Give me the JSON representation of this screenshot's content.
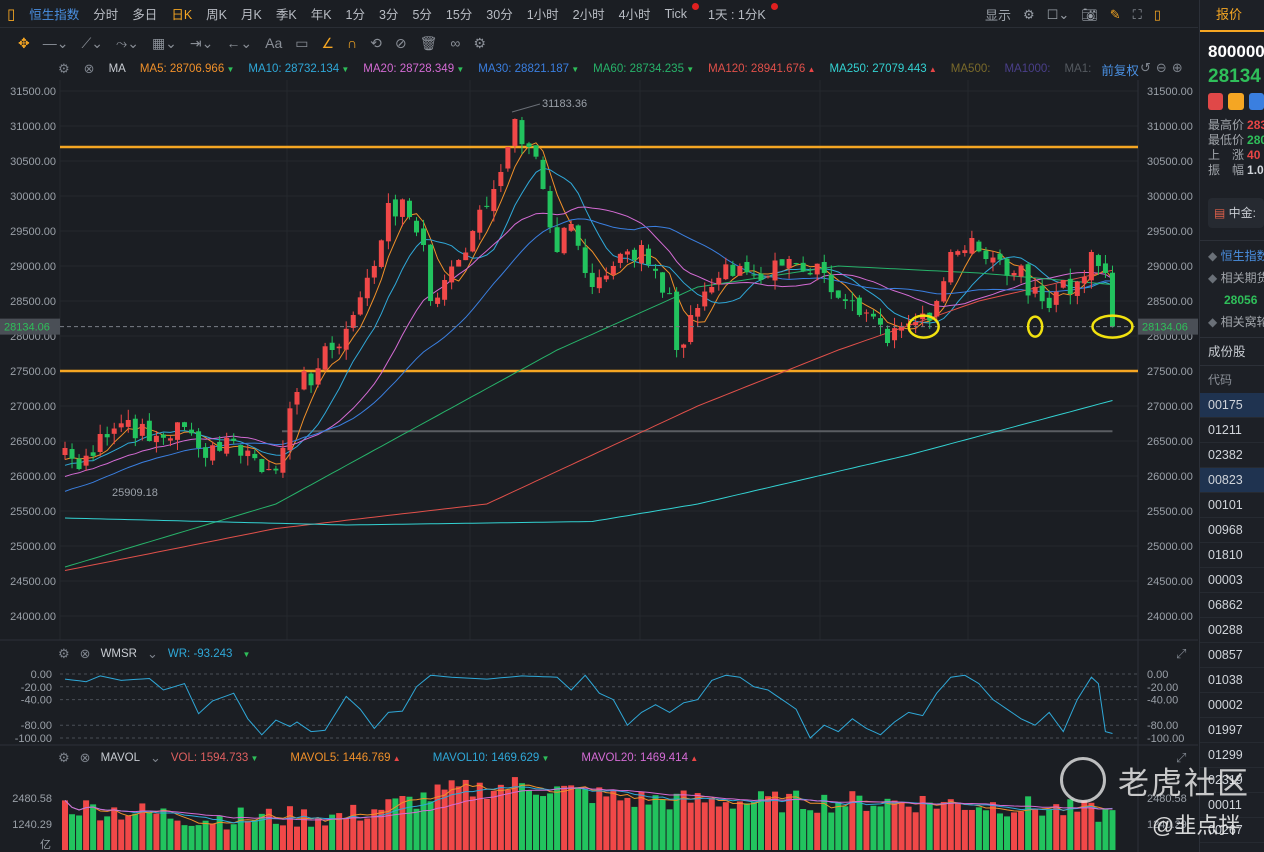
{
  "topbar": {
    "items": [
      {
        "label": "恒生指数",
        "kind": "sym"
      },
      {
        "label": "分时"
      },
      {
        "label": "多日"
      },
      {
        "label": "日K",
        "kind": "active"
      },
      {
        "label": "周K"
      },
      {
        "label": "月K"
      },
      {
        "label": "季K"
      },
      {
        "label": "年K"
      },
      {
        "label": "1分"
      },
      {
        "label": "3分"
      },
      {
        "label": "5分"
      },
      {
        "label": "15分"
      },
      {
        "label": "30分"
      },
      {
        "label": "1小时"
      },
      {
        "label": "2小时"
      },
      {
        "label": "4小时"
      },
      {
        "label": "Tick"
      },
      {
        "label": "1天 : 1分K"
      }
    ],
    "display_label": "显示"
  },
  "ma_legend": {
    "name": "MA",
    "items": [
      {
        "label": "MA5: 28706.966",
        "color": "#f0902a",
        "dir": "down"
      },
      {
        "label": "MA10: 28732.134",
        "color": "#2fa8d8",
        "dir": "down"
      },
      {
        "label": "MA20: 28728.349",
        "color": "#d46bd4",
        "dir": "down"
      },
      {
        "label": "MA30: 28821.187",
        "color": "#3a7fe0",
        "dir": "down"
      },
      {
        "label": "MA60: 28734.235",
        "color": "#27b36a",
        "dir": "down"
      },
      {
        "label": "MA120: 28941.676",
        "color": "#e0504a",
        "dir": "up"
      },
      {
        "label": "MA250: 27079.443",
        "color": "#33d2d2",
        "dir": "up"
      },
      {
        "label": "MA500:",
        "color": "#7a6a2a"
      },
      {
        "label": "MA1000:",
        "color": "#4a3f8a"
      },
      {
        "label": "MA1:",
        "color": "#555a60"
      }
    ],
    "adjust": "前复权"
  },
  "chart_data": {
    "type": "candlestick",
    "price_axis": {
      "min": 24000,
      "max": 31500,
      "ticks": [
        "31500.00",
        "31000.00",
        "30500.00",
        "30000.00",
        "29500.00",
        "29000.00",
        "28500.00",
        "28000.00",
        "27500.00",
        "27000.00",
        "26500.00",
        "26000.00",
        "25500.00",
        "25000.00",
        "24500.00",
        "24000.00"
      ]
    },
    "last_price": "28134.06",
    "last_price_value": 28134.06,
    "high_label": "31183.36",
    "high_value": 31183.36,
    "low_label": "25909.18",
    "low_value": 25909.18,
    "hlines": [
      {
        "value": 30700,
        "color": "#f5a623"
      },
      {
        "value": 27500,
        "color": "#f5a623"
      },
      {
        "value": 26640,
        "color": "#5a5d62",
        "from_index": 32
      }
    ],
    "close_keypoints": [
      [
        0,
        26400
      ],
      [
        2,
        26100
      ],
      [
        5,
        26600
      ],
      [
        9,
        26800
      ],
      [
        12,
        26500
      ],
      [
        17,
        26700
      ],
      [
        19,
        26400
      ],
      [
        24,
        26500
      ],
      [
        29,
        26100
      ],
      [
        31,
        26400
      ],
      [
        33,
        27200
      ],
      [
        38,
        27800
      ],
      [
        41,
        28300
      ],
      [
        44,
        29000
      ],
      [
        46,
        29900
      ],
      [
        49,
        29700
      ],
      [
        51,
        29300
      ],
      [
        52,
        28500
      ],
      [
        54,
        28800
      ],
      [
        58,
        29500
      ],
      [
        61,
        30100
      ],
      [
        63,
        30700
      ],
      [
        64,
        31100
      ],
      [
        66,
        30700
      ],
      [
        68,
        30100
      ],
      [
        70,
        29200
      ],
      [
        72,
        29600
      ],
      [
        75,
        28700
      ],
      [
        78,
        29000
      ],
      [
        82,
        29300
      ],
      [
        86,
        28600
      ],
      [
        87,
        27800
      ],
      [
        89,
        28300
      ],
      [
        92,
        28700
      ],
      [
        96,
        29000
      ],
      [
        99,
        28800
      ],
      [
        103,
        29100
      ],
      [
        108,
        28900
      ],
      [
        111,
        28500
      ],
      [
        113,
        28300
      ],
      [
        117,
        27900
      ],
      [
        121,
        28200
      ],
      [
        124,
        28500
      ],
      [
        126,
        29200
      ],
      [
        129,
        29400
      ],
      [
        131,
        29100
      ],
      [
        135,
        28900
      ],
      [
        138,
        28700
      ],
      [
        140,
        28400
      ],
      [
        142,
        28800
      ],
      [
        143,
        28600
      ],
      [
        146,
        29200
      ],
      [
        147,
        29000
      ],
      [
        148,
        28900
      ],
      [
        149,
        28134
      ]
    ],
    "pre_history_start": 24000,
    "ma_long": {
      "MA60": [
        [
          0,
          24700
        ],
        [
          30,
          25600
        ],
        [
          50,
          26700
        ],
        [
          70,
          27800
        ],
        [
          90,
          28700
        ],
        [
          110,
          29000
        ],
        [
          130,
          28900
        ],
        [
          149,
          28734
        ]
      ],
      "MA120": [
        [
          0,
          24650
        ],
        [
          30,
          25250
        ],
        [
          60,
          25600
        ],
        [
          90,
          27000
        ],
        [
          110,
          27800
        ],
        [
          130,
          28500
        ],
        [
          149,
          28940
        ]
      ],
      "MA250": [
        [
          0,
          25400
        ],
        [
          40,
          25300
        ],
        [
          75,
          25350
        ],
        [
          90,
          25600
        ],
        [
          120,
          26300
        ],
        [
          149,
          27079
        ]
      ]
    },
    "highlights": [
      123,
      138,
      149
    ],
    "wr": {
      "label": "WMSR",
      "value_label": "WR: -93.243",
      "ticks": [
        "0.00",
        "-20.00",
        "-40.00",
        "-80.00",
        "-100.00"
      ],
      "keypoints": [
        [
          0,
          -8
        ],
        [
          3,
          -12
        ],
        [
          5,
          -3
        ],
        [
          8,
          -10
        ],
        [
          12,
          -7
        ],
        [
          14,
          -25
        ],
        [
          17,
          -15
        ],
        [
          19,
          -62
        ],
        [
          21,
          -42
        ],
        [
          24,
          -30
        ],
        [
          26,
          -70
        ],
        [
          28,
          -95
        ],
        [
          30,
          -72
        ],
        [
          32,
          -82
        ],
        [
          33,
          -75
        ],
        [
          35,
          -90
        ],
        [
          37,
          -88
        ],
        [
          40,
          -35
        ],
        [
          42,
          -55
        ],
        [
          44,
          -85
        ],
        [
          46,
          -60
        ],
        [
          48,
          -58
        ],
        [
          50,
          -20
        ],
        [
          52,
          -2
        ],
        [
          55,
          -5
        ],
        [
          60,
          -8
        ],
        [
          65,
          -3
        ],
        [
          70,
          -5
        ],
        [
          72,
          -25
        ],
        [
          74,
          -2
        ],
        [
          76,
          -30
        ],
        [
          78,
          -40
        ],
        [
          80,
          -80
        ],
        [
          82,
          -60
        ],
        [
          84,
          -48
        ],
        [
          86,
          -60
        ],
        [
          88,
          -45
        ],
        [
          90,
          -40
        ],
        [
          92,
          -10
        ],
        [
          94,
          -2
        ],
        [
          96,
          -5
        ],
        [
          98,
          -20
        ],
        [
          100,
          -25
        ],
        [
          102,
          -40
        ],
        [
          104,
          -55
        ],
        [
          106,
          -100
        ],
        [
          108,
          -80
        ],
        [
          110,
          -90
        ],
        [
          112,
          -70
        ],
        [
          114,
          -85
        ],
        [
          116,
          -95
        ],
        [
          118,
          -75
        ],
        [
          120,
          -60
        ],
        [
          122,
          -65
        ],
        [
          124,
          -30
        ],
        [
          126,
          -5
        ],
        [
          128,
          -2
        ],
        [
          130,
          -15
        ],
        [
          132,
          -40
        ],
        [
          134,
          -55
        ],
        [
          136,
          -70
        ],
        [
          138,
          -80
        ],
        [
          140,
          -60
        ],
        [
          142,
          -90
        ],
        [
          144,
          -40
        ],
        [
          146,
          -5
        ],
        [
          147,
          -15
        ],
        [
          148,
          -90
        ],
        [
          149,
          -93
        ]
      ]
    },
    "vol": {
      "label": "MAVOL",
      "items": [
        {
          "label": "VOL: 1594.733",
          "color": "#e06060",
          "dir": "down"
        },
        {
          "label": "MAVOL5: 1446.769",
          "color": "#f0902a",
          "dir": "up"
        },
        {
          "label": "MAVOL10: 1469.629",
          "color": "#2fa8d8",
          "dir": "down"
        },
        {
          "label": "MAVOL20: 1469.414",
          "color": "#d46bd4",
          "dir": "up"
        }
      ],
      "ticks": [
        "2480.58",
        "1240.29"
      ],
      "unit": "亿",
      "keypoints": [
        [
          0,
          2000
        ],
        [
          20,
          1400
        ],
        [
          40,
          1500
        ],
        [
          55,
          2700
        ],
        [
          65,
          3000
        ],
        [
          80,
          2300
        ],
        [
          100,
          2200
        ],
        [
          120,
          2200
        ],
        [
          135,
          2000
        ],
        [
          149,
          1600
        ]
      ]
    }
  },
  "right_panel": {
    "tab": "报价",
    "code": "800000",
    "price": "28134",
    "stats": [
      {
        "k": "最高价",
        "v": "283",
        "c": "#e84545"
      },
      {
        "k": "最低价",
        "v": "280",
        "c": "#2fbf5a"
      },
      {
        "k": "上　涨",
        "v": "40",
        "c": "#e84545"
      },
      {
        "k": "振　幅",
        "v": "1.0",
        "c": "#d0d4da"
      }
    ],
    "news": "中金:",
    "related": [
      {
        "label": "恒生指数",
        "c": "#4a90e2"
      },
      {
        "label": "相关期货",
        "c": "#a0a4aa"
      },
      {
        "label": "28056",
        "c": "#2fbf5a"
      },
      {
        "label": "相关窝轮",
        "c": "#a0a4aa"
      }
    ],
    "section": "成份股",
    "col": "代码",
    "codes": [
      "00175",
      "01211",
      "02382",
      "00823",
      "00101",
      "00968",
      "01810",
      "00003",
      "06862",
      "00288",
      "00857",
      "01038",
      "00002",
      "01997",
      "01299",
      "02319",
      "00011",
      "00267"
    ]
  },
  "watermark": {
    "brand": "老虎社区",
    "author": "@韭点拌"
  }
}
